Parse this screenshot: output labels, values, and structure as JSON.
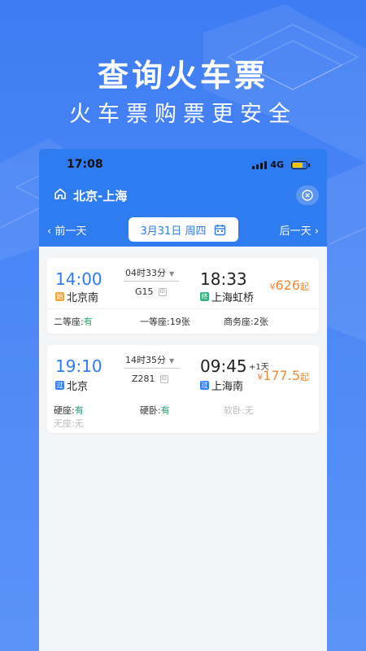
{
  "promo": {
    "headline": "查询火车票",
    "subline": "火车票购票更安全"
  },
  "status_bar": {
    "time": "17:08",
    "network": "4G"
  },
  "route": {
    "title": "北京-上海"
  },
  "date_nav": {
    "prev": "前一天",
    "date": "3月31日 周四",
    "next": "后一天"
  },
  "trains": [
    {
      "depart_time": "14:00",
      "depart_station": "北京南",
      "depart_badge": "始",
      "duration": "04时33分",
      "train_no": "G15",
      "id_tag": "ID",
      "arrive_time": "18:33",
      "arrive_station": "上海虹桥",
      "arrive_badge": "终",
      "price_symbol": "¥",
      "price": "626",
      "price_suffix": "起",
      "seats": [
        {
          "label": "二等座:",
          "value": "有"
        },
        {
          "label": "一等座:",
          "value": "19张"
        },
        {
          "label": "商务座:",
          "value": "2张"
        }
      ]
    },
    {
      "depart_time": "19:10",
      "depart_station": "北京",
      "depart_badge": "过",
      "duration": "14时35分",
      "train_no": "Z281",
      "id_tag": "ID",
      "arrive_time": "09:45",
      "plus_day": "+1天",
      "arrive_station": "上海南",
      "arrive_badge": "过",
      "price_symbol": "¥",
      "price": "177.5",
      "price_suffix": "起",
      "seats": [
        {
          "label": "硬座:",
          "value": "有"
        },
        {
          "label": "硬卧:",
          "value": "有"
        },
        {
          "label": "软卧:",
          "value": "无"
        },
        {
          "label": "无座:",
          "value": "无"
        }
      ]
    }
  ],
  "colors": {
    "primary": "#2f7bf0",
    "price": "#f08a3a",
    "available": "#1ea36b",
    "badge_start": "#f2a53a",
    "badge_end": "#35b37e",
    "badge_pass": "#3b82f6"
  }
}
